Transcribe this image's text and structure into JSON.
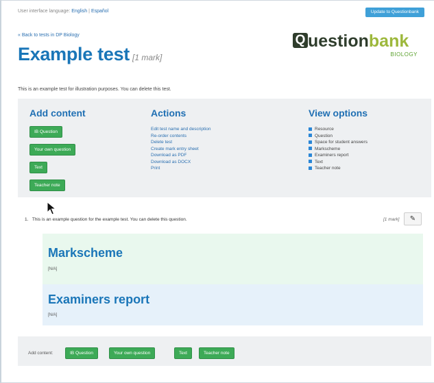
{
  "header": {
    "language_label": "User interface language:",
    "lang_english": "English",
    "lang_separator": "|",
    "lang_spanish": "Español",
    "update_button": "Update to Questionbank"
  },
  "nav": {
    "back_link": "« Back to tests in DP Biology"
  },
  "test": {
    "title": "Example test",
    "marks": "[1 mark]",
    "description": "This is an example test for illustration purposes. You can delete this test."
  },
  "logo": {
    "q": "Q",
    "text_uestion": "uestion",
    "text_bank": "bank",
    "subtitle": "BIOLOGY"
  },
  "add_content": {
    "heading": "Add content",
    "buttons": [
      "IB Question",
      "Your own question",
      "Text",
      "Teacher note"
    ]
  },
  "actions": {
    "heading": "Actions",
    "items": [
      "Edit test name and description",
      "Re-order contents",
      "Delete test",
      "Create mark entry sheet",
      "Download as PDF",
      "Download as DOCX",
      "Print"
    ]
  },
  "view_options": {
    "heading": "View options",
    "items": [
      "Resource",
      "Question",
      "Space for student answers",
      "Markscheme",
      "Examiners report",
      "Text",
      "Teacher note"
    ]
  },
  "question": {
    "number": "1.",
    "text": "This is an example question for the example test. You can delete this question.",
    "marks": "[1 mark]"
  },
  "markscheme": {
    "title": "Markscheme",
    "value": "[N/A]"
  },
  "examiners_report": {
    "title": "Examiners report",
    "value": "[N/A]"
  },
  "bottom": {
    "label": "Add content:",
    "buttons": [
      "IB Question",
      "Your own question",
      "Text",
      "Teacher note"
    ]
  },
  "colors": {
    "accent_blue": "#1a76b8",
    "button_green": "#3daa57",
    "markscheme_bg": "#e9f8ee",
    "report_bg": "#e6f1fa"
  },
  "icons": {
    "edit": "pencil-icon",
    "cursor": "mouse-pointer-icon",
    "checkbox": "checkbox-checked-icon"
  }
}
